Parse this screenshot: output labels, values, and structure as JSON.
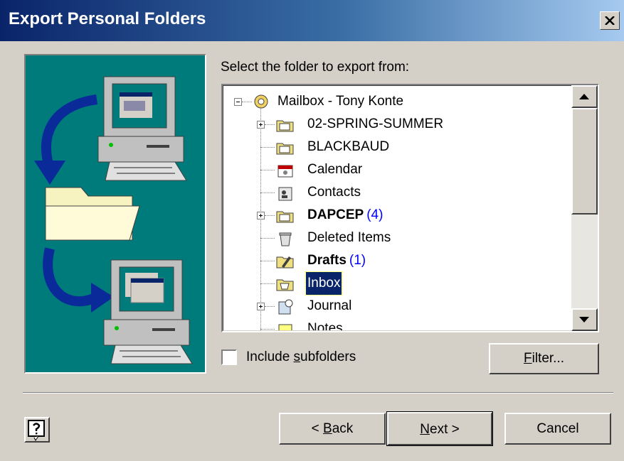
{
  "window": {
    "title": "Export Personal Folders"
  },
  "prompt": "Select the folder to export from:",
  "tree": {
    "items": [
      {
        "label": "Mailbox - Tony Konte",
        "icon": "outlook-today-icon",
        "count": ""
      },
      {
        "label": "02-SPRING-SUMMER",
        "icon": "mail-folder-icon",
        "count": ""
      },
      {
        "label": "BLACKBAUD",
        "icon": "mail-folder-icon",
        "count": ""
      },
      {
        "label": "Calendar",
        "icon": "calendar-icon",
        "count": ""
      },
      {
        "label": "Contacts",
        "icon": "contacts-icon",
        "count": ""
      },
      {
        "label": "DAPCEP",
        "icon": "mail-folder-icon",
        "count": "(4)"
      },
      {
        "label": "Deleted Items",
        "icon": "trash-icon",
        "count": ""
      },
      {
        "label": "Drafts",
        "icon": "drafts-icon",
        "count": "(1)"
      },
      {
        "label": "Inbox",
        "icon": "inbox-icon",
        "count": ""
      },
      {
        "label": "Journal",
        "icon": "journal-icon",
        "count": ""
      },
      {
        "label": "Notes",
        "icon": "notes-icon",
        "count": ""
      }
    ],
    "selected": "Inbox"
  },
  "options": {
    "subfolders_pre": "Include ",
    "subfolders_key": "s",
    "subfolders_post": "ubfolders",
    "subfolders_checked": false
  },
  "buttons": {
    "filter_key": "F",
    "filter_rest": "ilter...",
    "back_pre": "< ",
    "back_key": "B",
    "back_rest": "ack",
    "next_key": "N",
    "next_rest": "ext >",
    "cancel": "Cancel"
  },
  "colors": {
    "art_background": "#007b7b",
    "selection": "#0a246a",
    "count": "#0000ff",
    "dialog": "#d4d0c8"
  }
}
